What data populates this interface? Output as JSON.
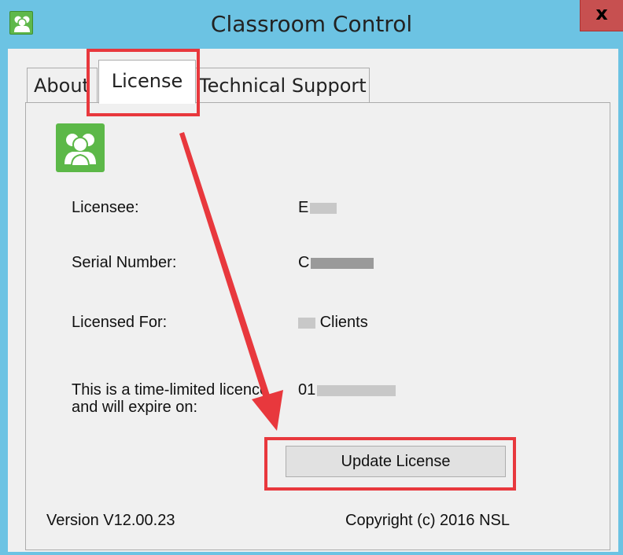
{
  "window": {
    "title": "Classroom Control",
    "close_glyph": "x",
    "app_icon": "people-icon"
  },
  "tabs": [
    {
      "label": "About",
      "selected": false
    },
    {
      "label": "License",
      "selected": true
    },
    {
      "label": "Technical Support",
      "selected": false
    }
  ],
  "license": {
    "licensee_label": "Licensee:",
    "licensee_value": "E",
    "serial_label": "Serial Number:",
    "serial_value": "C",
    "licensed_for_label": "Licensed For:",
    "licensed_for_value": "Clients",
    "expiry_label_line1": "This is a time-limited licence",
    "expiry_label_line2": "and will expire on:",
    "expiry_value": "01",
    "update_button": "Update License"
  },
  "footer": {
    "version": "Version V12.00.23",
    "copyright": "Copyright (c) 2016 NSL"
  },
  "annotation": {
    "highlight_color": "#e8383d"
  },
  "colors": {
    "titlebar": "#6cc3e3",
    "close_button": "#c75050",
    "logo_green": "#5cb848"
  }
}
